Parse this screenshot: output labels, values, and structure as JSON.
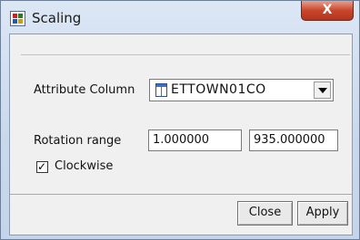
{
  "window": {
    "title": "Scaling",
    "close_glyph": "X",
    "icon": "app-grid-icon"
  },
  "form": {
    "attribute_label": "Attribute Column",
    "attribute_value": "ETTOWN01CO",
    "attribute_icon": "table-icon",
    "rotation_label": "Rotation range",
    "rotation_min": "1.000000",
    "rotation_max": "935.000000",
    "clockwise_label": "Clockwise",
    "clockwise_checked": true
  },
  "buttons": {
    "close": "Close",
    "apply": "Apply"
  },
  "colors": {
    "close_button": "#c9462c",
    "client_bg": "#f0f0f0",
    "frame": "#cfdcec"
  }
}
